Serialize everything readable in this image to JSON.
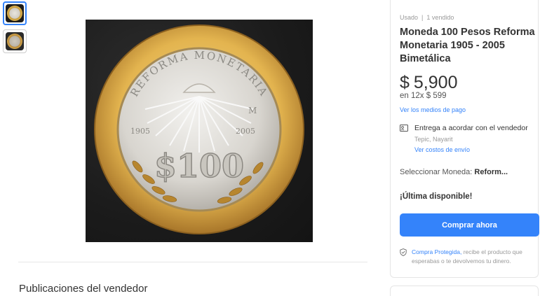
{
  "gallery": {
    "thumbnails": [
      {
        "alt": "coin-front",
        "active": true
      },
      {
        "alt": "coin-back",
        "active": false
      }
    ],
    "coin": {
      "top_text": "REFORMA MONETARIA",
      "year_left": "1905",
      "year_right": "2005",
      "mint_mark": "M",
      "denomination": "$100"
    }
  },
  "seller_section": {
    "title": "Publicaciones del vendedor"
  },
  "product": {
    "condition": "Usado  |  1 vendido",
    "title": "Moneda 100 Pesos Reforma Monetaria 1905 - 2005 Bimetálica",
    "price_currency": "$",
    "price_value": "5,900",
    "installments": "en 12x $ 599",
    "payment_link": "Ver los medios de pago",
    "shipping": {
      "icon": "id-card-icon",
      "title": "Entrega a acordar con el vendedor",
      "location": "Tepic, Nayarit",
      "cost_link": "Ver costos de envío"
    },
    "select_label": "Seleccionar Moneda: ",
    "select_value": "Reform...",
    "stock": "¡Última disponible!",
    "buy_button": "Comprar ahora",
    "protection_link": "Compra Protegida,",
    "protection_text": " recibe el producto que esperabas o te devolvemos tu dinero.",
    "colors": {
      "accent": "#3483fa"
    }
  }
}
